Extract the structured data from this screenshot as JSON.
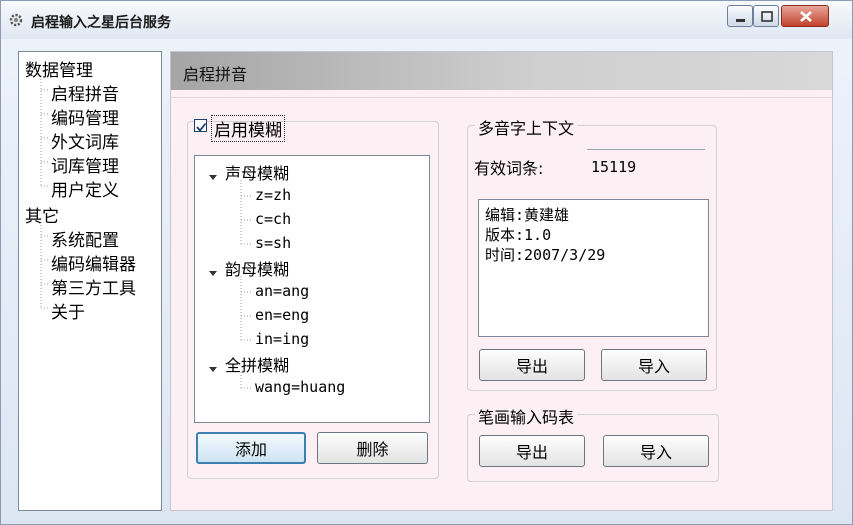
{
  "window": {
    "title": "启程输入之星后台服务",
    "app_icon": "gear-icon"
  },
  "nav": {
    "groups": [
      {
        "label": "数据管理",
        "items": [
          "启程拼音",
          "编码管理",
          "外文词库",
          "词库管理",
          "用户定义"
        ]
      },
      {
        "label": "其它",
        "items": [
          "系统配置",
          "编码编辑器",
          "第三方工具",
          "关于"
        ]
      }
    ]
  },
  "panel": {
    "header": "启程拼音",
    "fuzzy": {
      "enable_label": "启用模糊",
      "enabled": true,
      "tree": [
        {
          "label": "声母模糊",
          "items": [
            "z=zh",
            "c=ch",
            "s=sh"
          ]
        },
        {
          "label": "韵母模糊",
          "items": [
            "an=ang",
            "en=eng",
            "in=ing"
          ]
        },
        {
          "label": "全拼模糊",
          "items": [
            "wang=huang"
          ]
        }
      ],
      "add_label": "添加",
      "delete_label": "删除"
    },
    "polyphone": {
      "title": "多音字上下文",
      "count_label": "有效词条:",
      "count_value": "15119",
      "info_lines": [
        "编辑:黄建雄",
        "版本:1.0",
        "时间:2007/3/29"
      ],
      "export_label": "导出",
      "import_label": "导入"
    },
    "stroke": {
      "title": "笔画输入码表",
      "export_label": "导出",
      "import_label": "导入"
    }
  },
  "colors": {
    "panel_bg": "#fcf0f4",
    "default_button_border": "#3c7fb1",
    "close_button": "#c2432c"
  }
}
